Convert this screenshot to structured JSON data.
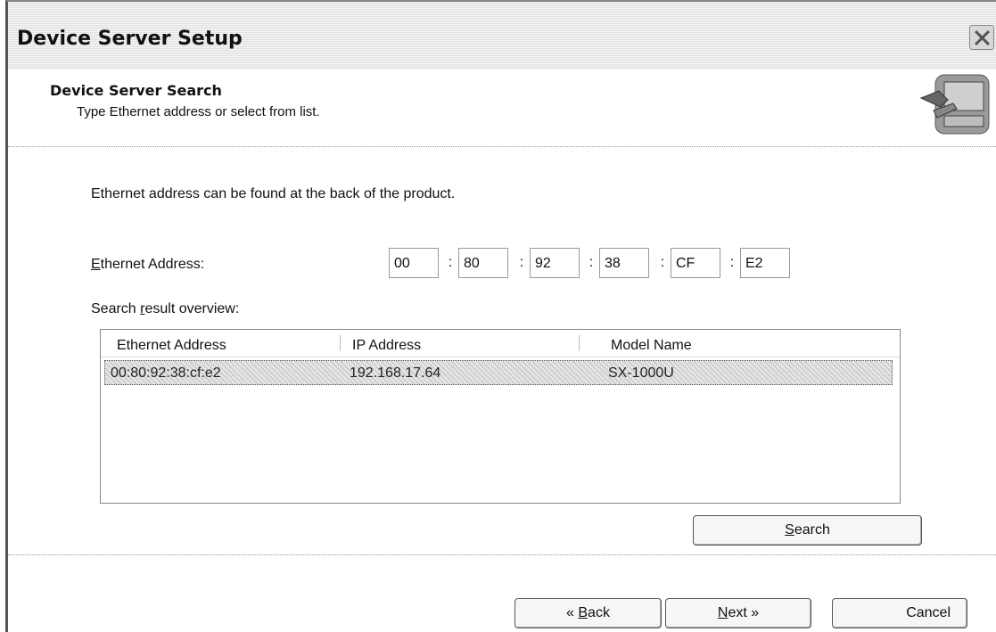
{
  "window": {
    "title": "Device Server Setup"
  },
  "header": {
    "title": "Device Server Search",
    "subtitle": "Type Ethernet address or select from list.",
    "icon": "setup-tools-icon"
  },
  "content": {
    "info_text": "Ethernet address can be found at the back of the product.",
    "ethernet_label_accel": "E",
    "ethernet_label_rest": "thernet Address:",
    "octets": [
      "00",
      "80",
      "92",
      "38",
      "CF",
      "E2"
    ],
    "separator": ":",
    "search_result_label_pre": "Search ",
    "search_result_label_accel": "r",
    "search_result_label_post": "esult overview:"
  },
  "list": {
    "columns": [
      "Ethernet Address",
      "IP Address",
      "Model Name"
    ],
    "rows": [
      {
        "ethernet": "00:80:92:38:cf:e2",
        "ip": "192.168.17.64",
        "model": "SX-1000U"
      }
    ]
  },
  "buttons": {
    "search_accel": "S",
    "search_rest": "earch",
    "back_pre": "« ",
    "back_accel": "B",
    "back_rest": "ack",
    "next_accel": "N",
    "next_rest": "ext »",
    "cancel": "Cancel"
  }
}
